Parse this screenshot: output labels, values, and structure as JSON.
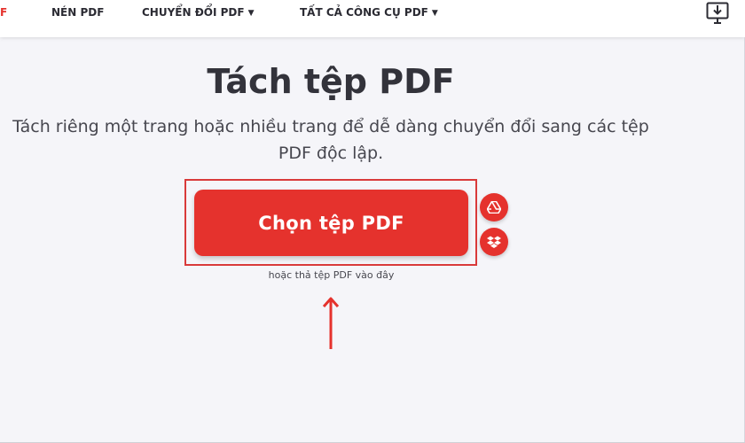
{
  "nav": {
    "items": [
      {
        "label": "F",
        "active": true
      },
      {
        "label": "NÉN PDF"
      },
      {
        "label": "CHUYỂN ĐỔI PDF"
      },
      {
        "label": "TẤT CẢ CÔNG CỤ PDF"
      }
    ],
    "caret": "▼",
    "download_icon": "desktop-download-icon"
  },
  "main": {
    "title": "Tách tệp PDF",
    "subtitle_line1": "Tách riêng một trang hoặc nhiều trang để dễ dàng chuyển đổi sang các tệp",
    "subtitle_line2": "PDF độc lập.",
    "select_button": "Chọn tệp PDF",
    "drop_hint": "hoặc thả tệp PDF vào đây",
    "cloud_icons": [
      "google-drive-icon",
      "dropbox-icon"
    ]
  },
  "colors": {
    "accent": "#e5322d",
    "annotation": "#d93a3a",
    "background": "#f5f5f9"
  }
}
